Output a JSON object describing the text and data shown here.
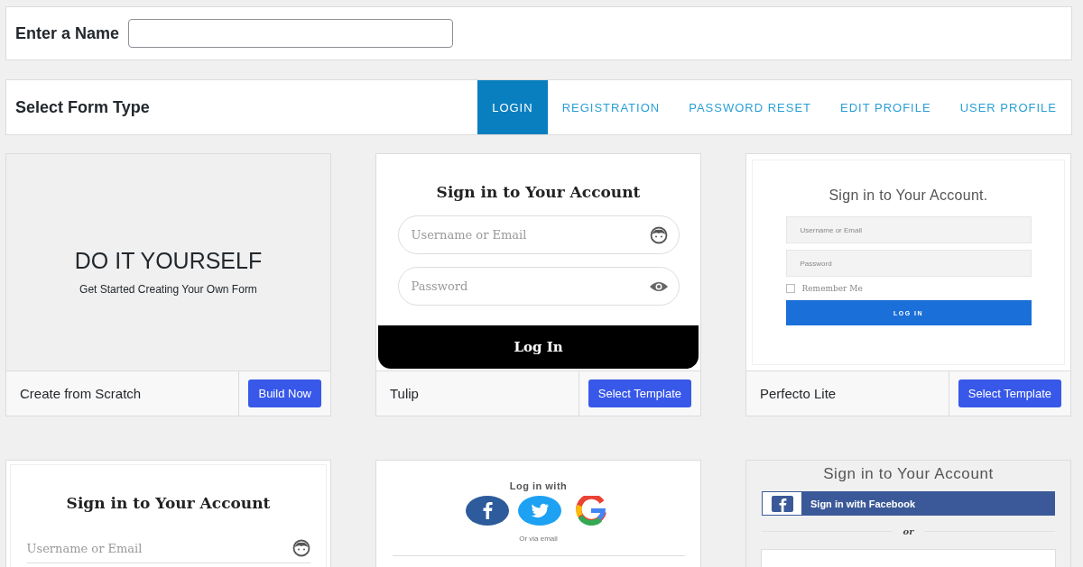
{
  "name_field": {
    "label": "Enter a Name"
  },
  "form_type": {
    "title": "Select Form Type",
    "tabs": [
      {
        "label": "LOGIN",
        "selected": true
      },
      {
        "label": "REGISTRATION",
        "selected": false
      },
      {
        "label": "PASSWORD RESET",
        "selected": false
      },
      {
        "label": "EDIT PROFILE",
        "selected": false
      },
      {
        "label": "USER PROFILE",
        "selected": false
      }
    ]
  },
  "templates": [
    {
      "name": "Create from Scratch",
      "button": "Build Now",
      "preview": {
        "kind": "diy",
        "title": "DO IT YOURSELF",
        "subtitle": "Get Started Creating Your Own Form"
      }
    },
    {
      "name": "Tulip",
      "button": "Select Template",
      "preview": {
        "kind": "tulip",
        "title": "Sign in to Your Account",
        "fields": [
          {
            "placeholder": "Username or Email"
          },
          {
            "placeholder": "Password"
          }
        ],
        "submit": "Log In"
      }
    },
    {
      "name": "Perfecto Lite",
      "button": "Select Template",
      "preview": {
        "kind": "perfecto",
        "title": "Sign in to Your Account.",
        "fields": [
          {
            "placeholder": "Username or Email"
          },
          {
            "placeholder": "Password"
          }
        ],
        "remember": {
          "label": "Remember Me",
          "checked": false
        },
        "submit": "LOG IN"
      }
    },
    {
      "preview": {
        "kind": "underline",
        "title": "Sign in to Your Account",
        "fields": [
          {
            "placeholder": "Username or Email"
          }
        ]
      }
    },
    {
      "preview": {
        "kind": "social",
        "heading": "Log in with",
        "note": "Or via email"
      }
    },
    {
      "preview": {
        "kind": "facebook",
        "title": "Sign in to Your Account",
        "social_button": "Sign in with Facebook",
        "divider": "or"
      }
    }
  ]
}
